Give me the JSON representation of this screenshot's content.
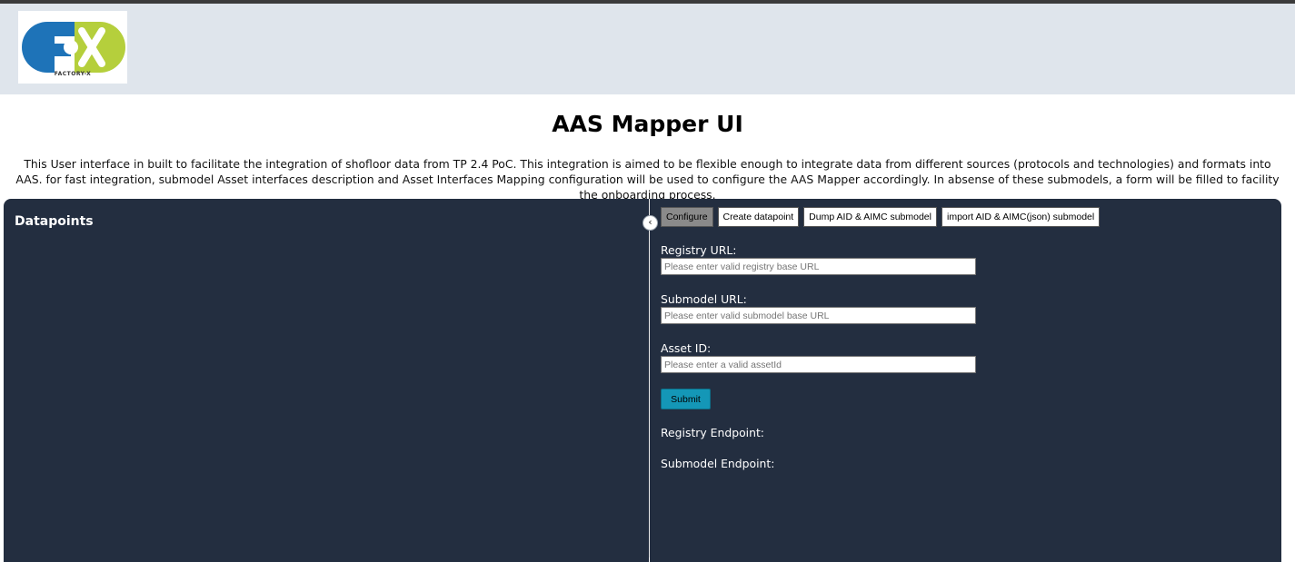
{
  "logo": {
    "caption": "FACTORY-X"
  },
  "page": {
    "title": "AAS Mapper UI",
    "intro": "This User interface in built to facilitate the integration of shofloor data from TP 2.4 PoC. This integration is aimed to be flexible enough to integrate data from different sources (protocols and technologies) and formats into AAS. for fast integration, submodel Asset interfaces description and Asset Interfaces Mapping configuration will be used to configure the AAS Mapper accordingly. In absense of these submodels, a form will be filled to facility the onboarding process."
  },
  "left_panel": {
    "heading": "Datapoints"
  },
  "collapse_button": {
    "glyph": "‹",
    "icon": "chevron-left-icon"
  },
  "tabs": [
    {
      "label": "Configure",
      "active": true
    },
    {
      "label": "Create datapoint",
      "active": false
    },
    {
      "label": "Dump AID & AIMC submodel",
      "active": false
    },
    {
      "label": "import AID & AIMC(json) submodel",
      "active": false
    }
  ],
  "form": {
    "registry": {
      "label": "Registry URL:",
      "placeholder": "Please enter valid registry base URL",
      "value": ""
    },
    "submodel": {
      "label": "Submodel URL:",
      "placeholder": "Please enter valid submodel base URL",
      "value": ""
    },
    "asset": {
      "label": "Asset ID:",
      "placeholder": "Please enter a valid assetId",
      "value": ""
    },
    "submit_label": "Submit"
  },
  "endpoints": {
    "registry_label": "Registry Endpoint:",
    "submodel_label": "Submodel Endpoint:"
  },
  "colors": {
    "header_bg": "#dfe5ec",
    "panel_bg": "#232e40",
    "submit_bg": "#1497b7",
    "logo_blue": "#1e73b8",
    "logo_green": "#b5cf3c"
  }
}
